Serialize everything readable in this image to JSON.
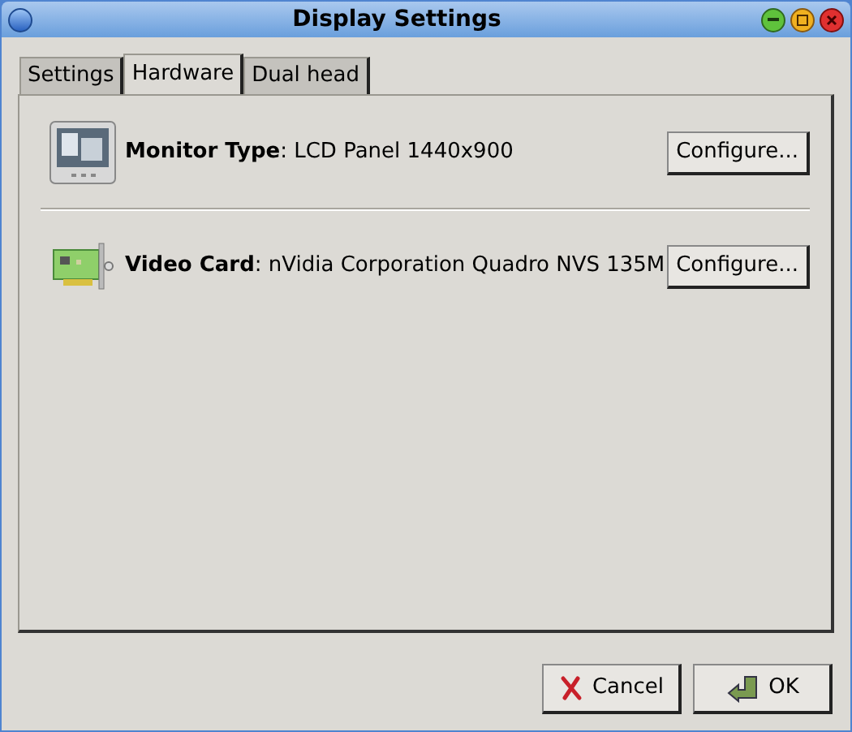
{
  "window": {
    "title": "Display Settings"
  },
  "tabs": [
    {
      "label": "Settings",
      "selected": false
    },
    {
      "label": "Hardware",
      "selected": true
    },
    {
      "label": "Dual head",
      "selected": false
    }
  ],
  "hardware": [
    {
      "kind": "monitor",
      "text": "**Monitor Type**: LCD Panel 1440x900",
      "button": "Configure..."
    },
    {
      "kind": "videocard",
      "text": "**Video Card**: nVidia Corporation Quadro NVS 135M",
      "button": "Configure..."
    }
  ],
  "buttons": [
    {
      "kind": "cancel",
      "label": "Cancel"
    },
    {
      "kind": "ok",
      "label": "OK"
    }
  ]
}
